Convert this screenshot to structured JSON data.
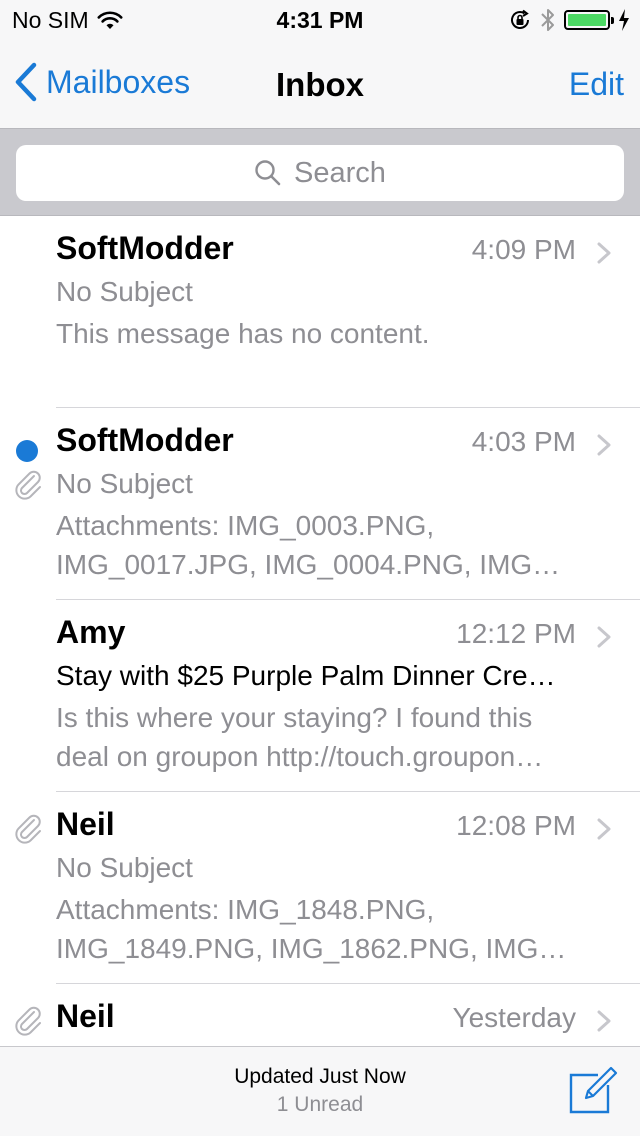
{
  "status_bar": {
    "carrier": "No SIM",
    "time": "4:31 PM"
  },
  "nav": {
    "back_label": "Mailboxes",
    "title": "Inbox",
    "edit_label": "Edit"
  },
  "search": {
    "placeholder": "Search"
  },
  "messages": [
    {
      "sender": "SoftModder",
      "time": "4:09 PM",
      "subject": "No Subject",
      "preview": [
        "This message has no content."
      ],
      "unread": false,
      "attachment": false
    },
    {
      "sender": "SoftModder",
      "time": "4:03 PM",
      "subject": "No Subject",
      "preview": [
        "Attachments: IMG_0003.PNG,",
        "IMG_0017.JPG, IMG_0004.PNG, IMG…"
      ],
      "unread": true,
      "attachment": true
    },
    {
      "sender": "Amy",
      "time": "12:12 PM",
      "subject": "Stay with $25 Purple Palm Dinner Cre…",
      "preview": [
        "Is this where your staying? I found this",
        "deal on groupon http://touch.groupon…"
      ],
      "unread": false,
      "attachment": false
    },
    {
      "sender": "Neil",
      "time": "12:08 PM",
      "subject": "No Subject",
      "preview": [
        "Attachments: IMG_1848.PNG,",
        "IMG_1849.PNG, IMG_1862.PNG, IMG…"
      ],
      "unread": false,
      "attachment": true
    },
    {
      "sender": "Neil",
      "time": "Yesterday",
      "subject": "",
      "preview": [],
      "unread": false,
      "attachment": true
    }
  ],
  "toolbar": {
    "updated": "Updated Just Now",
    "unread_count": "1 Unread"
  },
  "colors": {
    "accent": "#1a7ad6",
    "secondary_text": "#8e8e93",
    "battery": "#4cd964"
  },
  "icons": {
    "wifi": "wifi-icon",
    "rotation_lock": "rotation-lock-icon",
    "bluetooth": "bluetooth-icon",
    "battery": "battery-icon",
    "charging": "charging-bolt-icon",
    "back": "chevron-left-icon",
    "search": "search-icon",
    "attachment": "paperclip-icon",
    "disclosure": "chevron-right-icon",
    "compose": "compose-icon"
  }
}
